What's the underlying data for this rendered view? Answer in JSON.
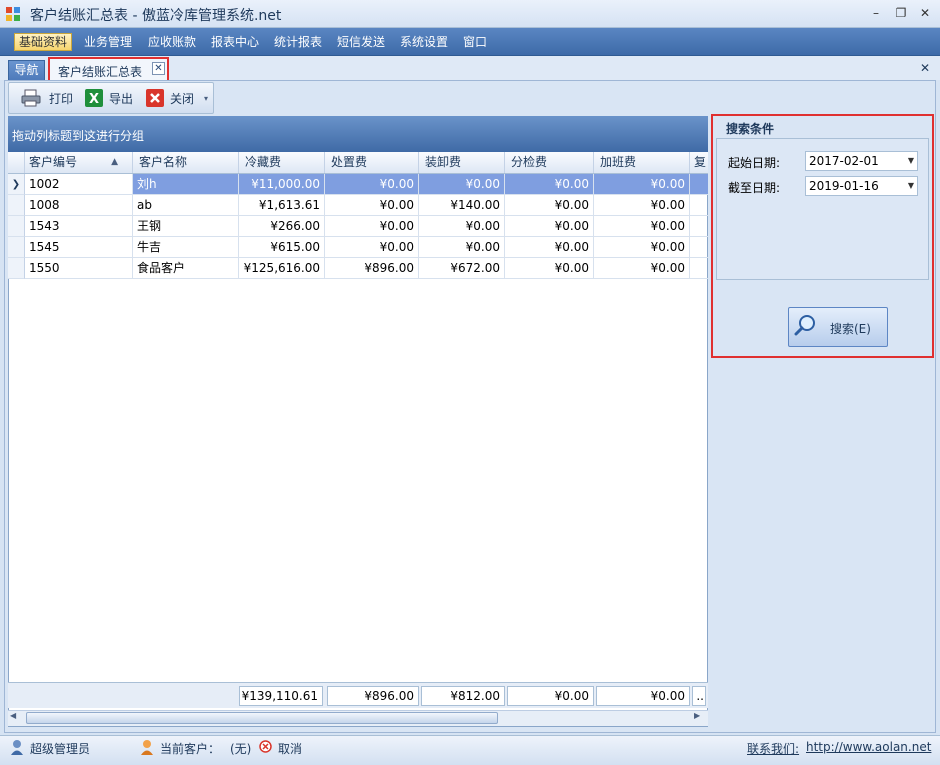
{
  "window": {
    "title": "客户结账汇总表 - 傲蓝冷库管理系统.net",
    "minimize": "–",
    "restore": "❐",
    "close": "✕"
  },
  "menu": [
    "基础资料",
    "业务管理",
    "应收账款",
    "报表中心",
    "统计报表",
    "短信发送",
    "系统设置",
    "窗口"
  ],
  "tabs": {
    "nav": "导航",
    "report": "客户结账汇总表",
    "close": "✕",
    "panel_close": "✕"
  },
  "toolbar": {
    "print": "打印",
    "export": "导出",
    "close": "关闭"
  },
  "grid": {
    "group_hint": "拖动列标题到这进行分组",
    "columns": [
      "客户编号",
      "客户名称",
      "冷藏费",
      "处置费",
      "装卸费",
      "分检费",
      "加班费",
      "复"
    ],
    "sort_indicator": "▲",
    "rows": [
      {
        "id": "1002",
        "name": "刘h",
        "cold": "¥11,000.00",
        "disposal": "¥0.00",
        "handling": "¥0.00",
        "sorting": "¥0.00",
        "overtime": "¥0.00"
      },
      {
        "id": "1008",
        "name": "ab",
        "cold": "¥1,613.61",
        "disposal": "¥0.00",
        "handling": "¥140.00",
        "sorting": "¥0.00",
        "overtime": "¥0.00"
      },
      {
        "id": "1543",
        "name": "王钢",
        "cold": "¥266.00",
        "disposal": "¥0.00",
        "handling": "¥0.00",
        "sorting": "¥0.00",
        "overtime": "¥0.00"
      },
      {
        "id": "1545",
        "name": "牛吉",
        "cold": "¥615.00",
        "disposal": "¥0.00",
        "handling": "¥0.00",
        "sorting": "¥0.00",
        "overtime": "¥0.00"
      },
      {
        "id": "1550",
        "name": "食品客户",
        "cold": "¥125,616.00",
        "disposal": "¥896.00",
        "handling": "¥672.00",
        "sorting": "¥0.00",
        "overtime": "¥0.00"
      }
    ],
    "totals": {
      "cold": "¥139,110.61",
      "disposal": "¥896.00",
      "handling": "¥812.00",
      "sorting": "¥0.00",
      "overtime": "¥0.00",
      "more": ".."
    }
  },
  "search": {
    "title": "搜索条件",
    "start_label": "起始日期:",
    "start_value": "2017-02-01",
    "end_label": "截至日期:",
    "end_value": "2019-01-16",
    "button": "搜索(E)"
  },
  "status": {
    "user": "超级管理员",
    "current_customer_label": "当前客户：",
    "current_customer_value": "(无)",
    "cancel": "取消",
    "contact_label": "联系我们:",
    "contact_url": "http://www.aolan.net"
  },
  "colors": {
    "accent_blue": "#4d79b9",
    "highlight_red": "#e03030",
    "selected_row": "#7f9ee0"
  }
}
